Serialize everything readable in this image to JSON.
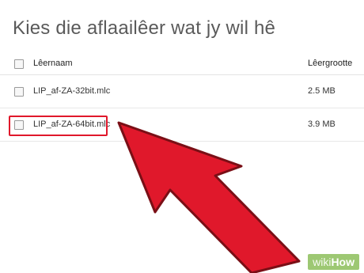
{
  "dialog": {
    "title": "Kies die aflaailêer wat jy wil hê"
  },
  "table": {
    "columns": {
      "name": "Lêernaam",
      "size": "Lêergrootte"
    },
    "rows": [
      {
        "name": "LIP_af-ZA-32bit.mlc",
        "size": "2.5 MB"
      },
      {
        "name": "LIP_af-ZA-64bit.mlc",
        "size": "3.9 MB"
      }
    ]
  },
  "annotation": {
    "highlight_color": "#e0182b",
    "arrow_color": "#e0182b"
  },
  "watermark": {
    "part1": "wiki",
    "part2": "How"
  }
}
